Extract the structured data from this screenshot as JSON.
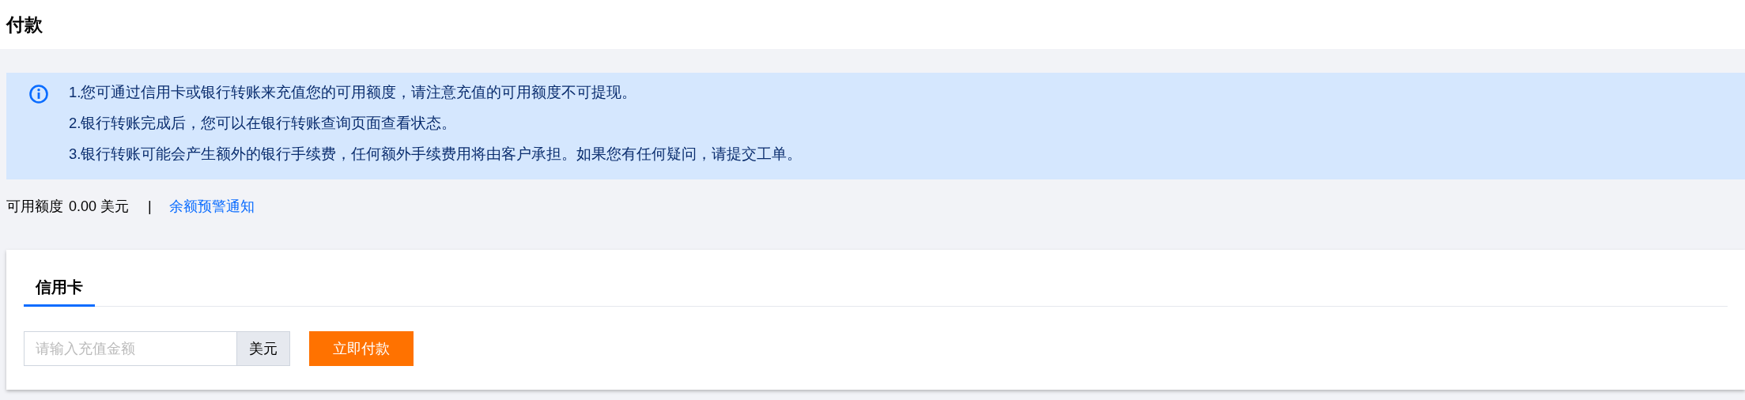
{
  "page_title": "付款",
  "notice": {
    "lines": [
      "1.您可通过信用卡或银行转账来充值您的可用额度，请注意充值的可用额度不可提现。",
      "2.银行转账完成后，您可以在银行转账查询页面查看状态。",
      "3.银行转账可能会产生额外的银行手续费，任何额外手续费用将由客户承担。如果您有任何疑问，请提交工单。"
    ]
  },
  "balance": {
    "label": "可用额度",
    "amount": "0.00 美元",
    "separator": "|",
    "link": "余额预警通知"
  },
  "tabs": [
    {
      "label": "信用卡",
      "selected": true
    }
  ],
  "amount_field": {
    "placeholder": "请输入充值金额",
    "unit": "美元"
  },
  "pay_button": "立即付款"
}
